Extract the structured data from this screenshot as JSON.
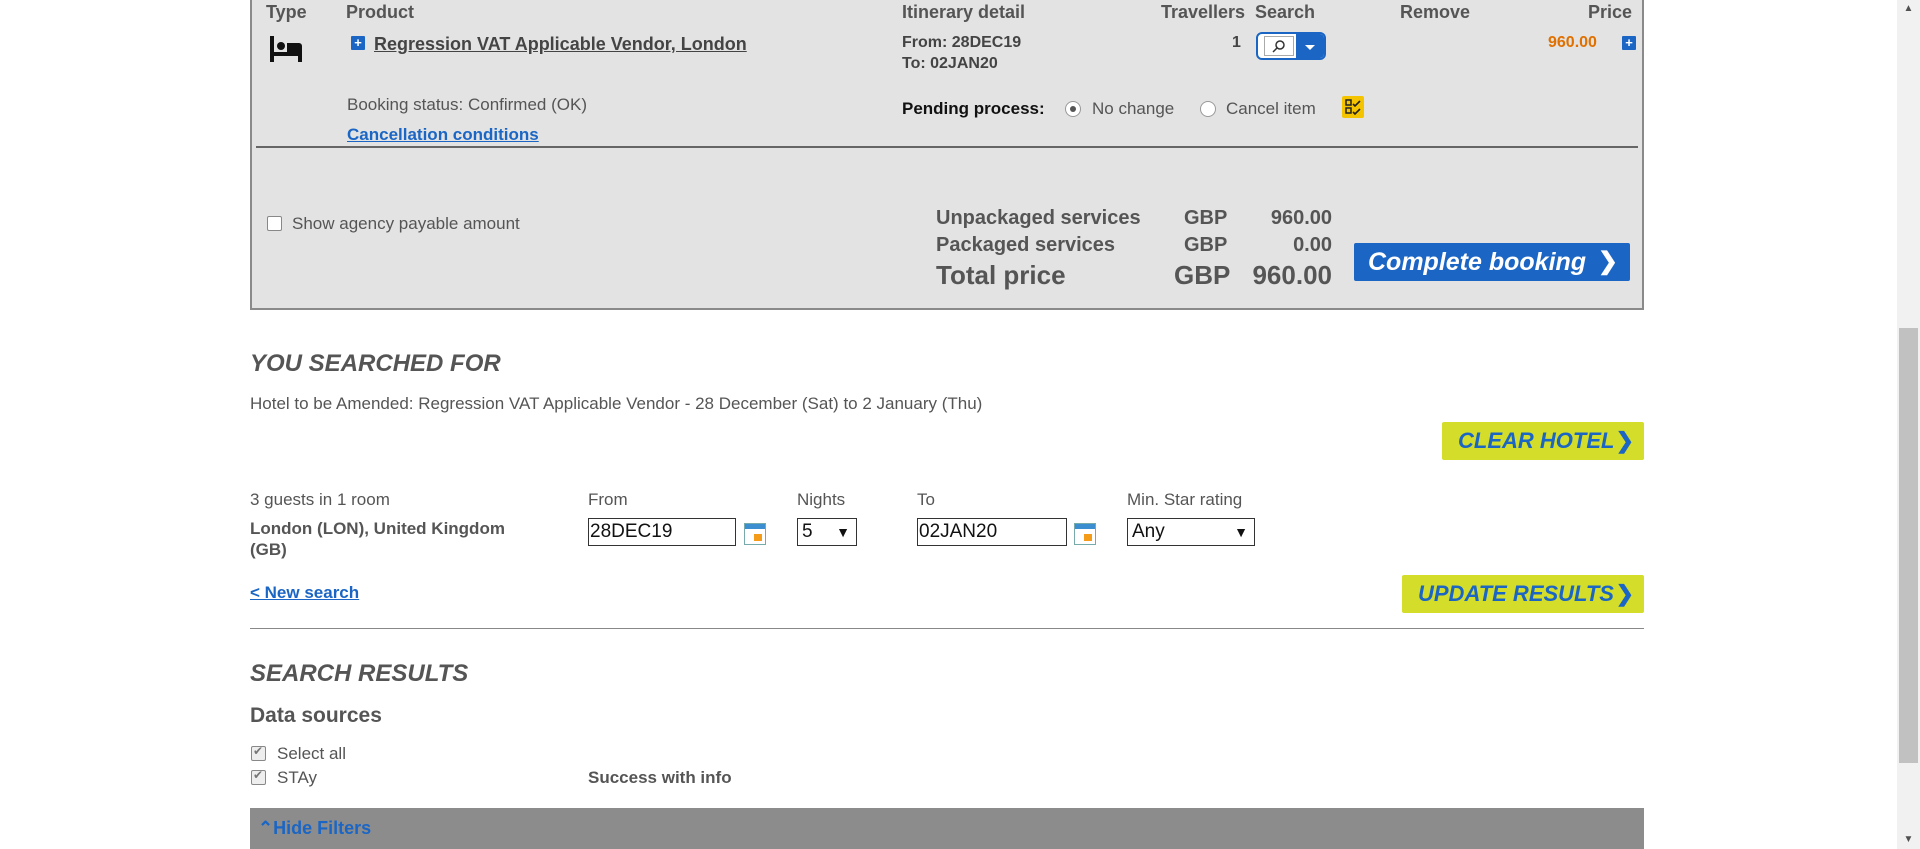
{
  "booking": {
    "headers": {
      "type": "Type",
      "product": "Product",
      "itinerary": "Itinerary detail",
      "travellers": "Travellers",
      "search": "Search",
      "remove": "Remove",
      "price": "Price"
    },
    "product_name": "Regression VAT Applicable Vendor, London",
    "itinerary_from": "From: 28DEC19",
    "itinerary_to": "To: 02JAN20",
    "travellers": "1",
    "price": "960.00",
    "booking_status": "Booking status: Confirmed (OK)",
    "cancellation_link": "Cancellation conditions",
    "pending_label": "Pending process:",
    "option_no_change": "No change",
    "option_cancel": "Cancel item",
    "show_agency_label": "Show agency payable amount",
    "summary": {
      "unpackaged_label": "Unpackaged services",
      "unpackaged_currency": "GBP",
      "unpackaged_amount": "960.00",
      "packaged_label": "Packaged services",
      "packaged_currency": "GBP",
      "packaged_amount": "0.00",
      "total_label": "Total price",
      "total_currency": "GBP",
      "total_amount": "960.00"
    },
    "complete_button": "Complete booking",
    "accent_color": "#1b66c4",
    "price_color": "#e07000"
  },
  "searched": {
    "title": "YOU SEARCHED FOR",
    "description": "Hotel to be Amended: Regression VAT Applicable Vendor - 28 December (Sat) to 2 January (Thu)",
    "clear_button": "CLEAR HOTEL",
    "guests": "3 guests in 1 room",
    "location": "London (LON), United Kingdom (GB)",
    "from_label": "From",
    "from_value": "28DEC19",
    "nights_label": "Nights",
    "nights_value": "5",
    "to_label": "To",
    "to_value": "02JAN20",
    "star_label": "Min. Star rating",
    "star_value": "Any",
    "new_search_link": "< New search",
    "update_button": "UPDATE RESULTS",
    "button_color": "#d3dd2a"
  },
  "results": {
    "title": "SEARCH RESULTS",
    "data_sources_title": "Data sources",
    "select_all": "Select all",
    "source_name": "STAy",
    "source_status": "Success with info",
    "hide_filters": "Hide Filters"
  }
}
